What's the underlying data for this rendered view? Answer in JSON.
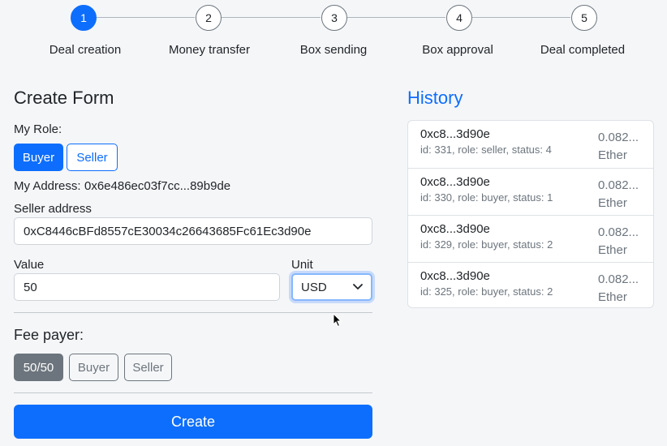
{
  "stepper": {
    "steps": [
      {
        "number": "1",
        "label": "Deal creation"
      },
      {
        "number": "2",
        "label": "Money transfer"
      },
      {
        "number": "3",
        "label": "Box sending"
      },
      {
        "number": "4",
        "label": "Box approval"
      },
      {
        "number": "5",
        "label": "Deal completed"
      }
    ],
    "active_step": 1
  },
  "form": {
    "title": "Create Form",
    "role_label": "My Role:",
    "role_options": [
      "Buyer",
      "Seller"
    ],
    "role_selected": "Buyer",
    "address_label": "My Address:",
    "address_value": "0x6e486ec03f7cc...89b9de",
    "seller_address_label": "Seller address",
    "seller_address_value": "0xC8446cBFd8557cE30034c26643685Fc61Ec3d90e",
    "value_label": "Value",
    "value_value": "50",
    "unit_label": "Unit",
    "unit_selected": "USD",
    "fee_payer_label": "Fee payer:",
    "fee_payer_options": [
      "50/50",
      "Buyer",
      "Seller"
    ],
    "fee_payer_selected": "50/50",
    "create_label": "Create"
  },
  "history": {
    "title": "History",
    "items": [
      {
        "address": "0xc8...3d90e",
        "meta": "id: 331, role: seller, status: 4",
        "amount": "0.082...",
        "currency": "Ether"
      },
      {
        "address": "0xc8...3d90e",
        "meta": "id: 330, role: buyer, status: 1",
        "amount": "0.082...",
        "currency": "Ether"
      },
      {
        "address": "0xc8...3d90e",
        "meta": "id: 329, role: buyer, status: 2",
        "amount": "0.082...",
        "currency": "Ether"
      },
      {
        "address": "0xc8...3d90e",
        "meta": "id: 325, role: buyer, status: 2",
        "amount": "0.082...",
        "currency": "Ether"
      }
    ]
  },
  "colors": {
    "primary": "#0d6efd",
    "secondary": "#6c757d",
    "background": "#f5f6f8"
  },
  "icons": {
    "unit_dropdown": "chevron-down-icon",
    "cursor": "mouse-cursor-icon"
  }
}
